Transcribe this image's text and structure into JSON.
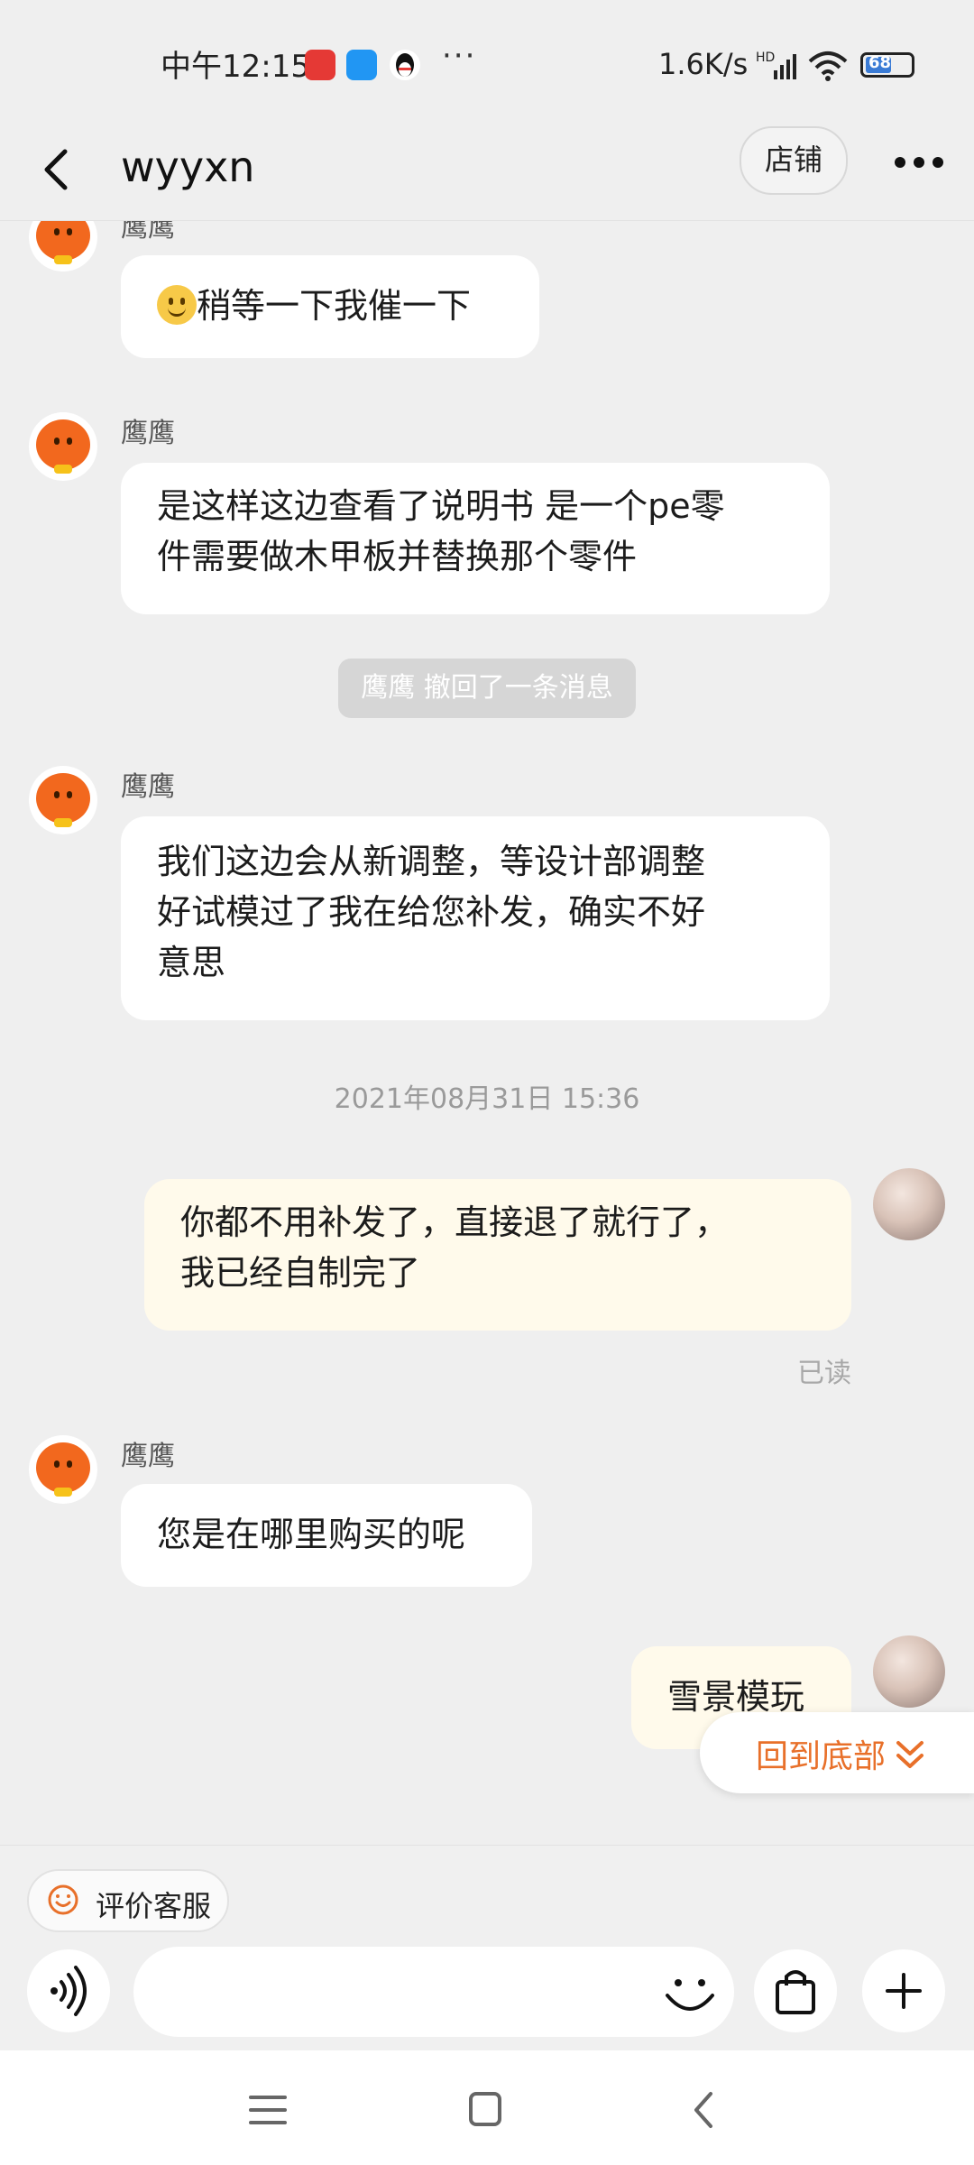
{
  "status_bar": {
    "time": "中午12:15",
    "notif_dots": "···",
    "net_speed": "1.6K/s",
    "hd": "HD",
    "battery": "68"
  },
  "header": {
    "title": "wyyxn",
    "shop_label": "店铺"
  },
  "chat": {
    "messages": [
      {
        "sender": "鹰鹰",
        "text": "稍等一下我催一下",
        "emoji": "slightly-smiling-face"
      },
      {
        "sender": "鹰鹰",
        "text_line1": "是这样这边查看了说明书 是一个pe零",
        "text_line2": "件需要做木甲板并替换那个零件"
      },
      {
        "system": "鹰鹰 撤回了一条消息"
      },
      {
        "sender": "鹰鹰",
        "text_line1": "我们这边会从新调整，等设计部调整",
        "text_line2": "好试模过了我在给您补发，确实不好",
        "text_line3": "意思"
      },
      {
        "timestamp": "2021年08月31日 15:36"
      },
      {
        "mine": true,
        "text_line1": "你都不用补发了，直接退了就行了，",
        "text_line2": "我已经自制完了",
        "status": "已读"
      },
      {
        "sender": "鹰鹰",
        "text": "您是在哪里购买的呢"
      },
      {
        "mine": true,
        "text": "雪景模玩"
      }
    ],
    "jump_to_bottom": "回到底部"
  },
  "composer": {
    "rate_service_label": "评价客服",
    "input_placeholder": ""
  },
  "colors": {
    "accent_orange": "#e8702a",
    "bubble_mine": "#fffaeb",
    "background": "#efefef"
  },
  "icons": [
    "back-arrow-icon",
    "more-icon",
    "voice-icon",
    "emoji-icon",
    "shopping-bag-icon",
    "plus-icon",
    "menu-icon",
    "home-icon",
    "back-nav-icon"
  ]
}
